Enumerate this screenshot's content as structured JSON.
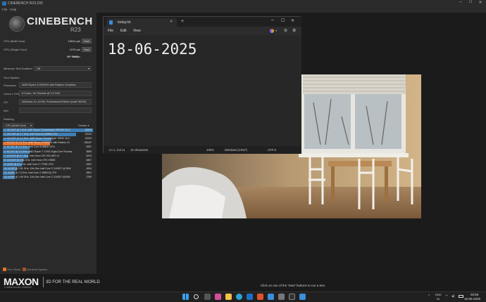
{
  "window": {
    "title": "CINEBENCH R23.200",
    "menu": [
      "File",
      "Help"
    ]
  },
  "logo": {
    "name": "CINEBENCH",
    "version": "R23"
  },
  "tests": [
    {
      "label": "CPU (Multi Core)",
      "value": "15644 pts",
      "button": "Start"
    },
    {
      "label": "CPU (Single Core)",
      "value": "1576 pts",
      "button": "Start"
    },
    {
      "label": "MP Ratio",
      "value": "9.58 x"
    }
  ],
  "duration": {
    "label": "Minimum Test Duration",
    "value": "Off"
  },
  "system": {
    "heading": "Your System",
    "rows": [
      {
        "label": "Processor",
        "value": "AMD Ryzen 9 6900HX with Radeon Graphics"
      },
      {
        "label": "Cores x GHz",
        "value": "8 Cores, 16 Threads @ 3.3 GHz"
      },
      {
        "label": "OS",
        "value": "Windows 10, 64 Bit, Professional Edition (build 26100)"
      },
      {
        "label": "Info",
        "value": ""
      }
    ]
  },
  "ranking": {
    "heading": "Ranking",
    "filter": "CPU (Multi Core)",
    "details": "Details",
    "items": [
      {
        "name": "1. 32C/64T @ 3 GHz, AMD Ryzen Threadripper 2990WX 32-C",
        "score": "30054",
        "fill": 1.0,
        "color": "#3f7fb5"
      },
      {
        "name": "2. 24C/48T @ 2.7 GHz, Intel Xeon W-3265M CPU",
        "score": "24243",
        "fill": 0.81,
        "color": "#3f7fb5"
      },
      {
        "name": "3. 16C/32T @ 3.4 GHz, AMD Ryzen Threadripper 1950X 16-C",
        "score": "16315",
        "fill": 0.54,
        "color": "#3f7fb5"
      },
      {
        "name": "4. 8C/16T @ 3.3 GHz, AMD Ryzen 9 6900HX with Radeon Gr",
        "score": "15644*",
        "fill": 0.52,
        "color": "#e0702a"
      },
      {
        "name": "5. 8C/16T @ 2.3 GHz, Intel Core i9-9880H CPU",
        "score": "9087",
        "fill": 0.3,
        "color": "#3f7fb5"
      },
      {
        "name": "6. 8C/16T @ 3.4 GHz, AMD Ryzen 7 1700X Eight-Core Process",
        "score": "8889",
        "fill": 0.3,
        "color": "#3f7fb5"
      },
      {
        "name": "7. 12C/24T @ 2.7 GHz, Intel Xeon CPU E5-2697 v2",
        "score": "8378",
        "fill": 0.28,
        "color": "#3f7fb5"
      },
      {
        "name": "8. 12C/24T @ 2.66 GHz, Intel Xeon CPU X5650",
        "score": "6867",
        "fill": 0.23,
        "color": "#3f7fb5"
      },
      {
        "name": "9. 4C/8T @ 4.2 GHz, Intel Core i7-7700K CPU",
        "score": "6302",
        "fill": 0.21,
        "color": "#3f7fb5"
      },
      {
        "name": "10. 4C/8T @ 2.81 GHz, 11th Gen Intel Core i7-1165G7 @ 28W",
        "score": "4904",
        "fill": 0.16,
        "color": "#3f7fb5"
      },
      {
        "name": "11. 4C/8T @ 2.3 GHz, Intel Core i7-4850HQ CPU",
        "score": "3891",
        "fill": 0.13,
        "color": "#3f7fb5"
      },
      {
        "name": "12. 4C/8T @ 1.69 GHz, 11th Gen Intel Core i7-1165G7 @15W",
        "score": "3769",
        "fill": 0.13,
        "color": "#3f7fb5"
      }
    ]
  },
  "legend": [
    {
      "label": "Your Score",
      "color": "#e0702a"
    },
    {
      "label": "Identical System",
      "color": "#a0522d"
    }
  ],
  "brand": {
    "name": "MAXON",
    "sub": "A NEMETSCHEK COMPANY",
    "tagline": "3D FOR THE REAL WORLD"
  },
  "status": "Click on one of the 'Start' buttons to run a test.",
  "notepad": {
    "tab": "today.txt",
    "menu": [
      "File",
      "Edit",
      "View"
    ],
    "content": "18-06-2025",
    "status": {
      "position": "Ln 1, Col 11",
      "chars": "10 characters",
      "zoom": "100%",
      "eol": "Windows (CRLF)",
      "encoding": "UTF-8"
    }
  },
  "taskbar": {
    "lang": "ENG",
    "region": "IN",
    "time": "03:59",
    "date": "18-06-2025"
  }
}
